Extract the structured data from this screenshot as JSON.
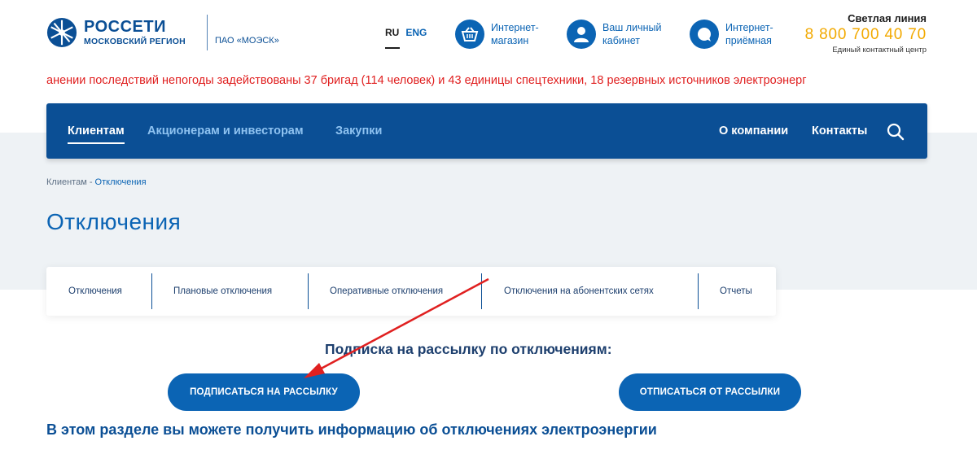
{
  "header": {
    "logo": {
      "name": "РОССЕТИ",
      "region": "МОСКОВСКИЙ РЕГИОН",
      "company": "ПАО «МОЭСК»"
    },
    "lang": {
      "ru": "RU",
      "eng": "ENG"
    },
    "links": [
      {
        "line1": "Интернет-",
        "line2": "магазин",
        "icon": "basket-icon"
      },
      {
        "line1": "Ваш личный",
        "line2": "кабинет",
        "icon": "user-icon"
      },
      {
        "line1": "Интернет-",
        "line2": "приёмная",
        "icon": "chat-icon"
      }
    ],
    "hotline": {
      "title": "Светлая линия",
      "phone": "8 800 700 40 70",
      "subtitle": "Единый контактный центр"
    }
  },
  "ticker": {
    "text": "анении последствий непогоды задействованы 37 бригад (114 человек) и 43 единицы спецтехники, 18 резервных источников электроэнерг"
  },
  "nav": {
    "left": [
      "Клиентам",
      "Акционерам и инвесторам",
      "Закупки"
    ],
    "right": [
      "О компании",
      "Контакты"
    ]
  },
  "breadcrumb": {
    "root": "Клиентам",
    "sep": " - ",
    "current": "Отключения"
  },
  "page_title": "Отключения",
  "tabs": [
    "Отключения",
    "Плановые отключения",
    "Оперативные отключения",
    "Отключения на абонентских сетях",
    "Отчеты"
  ],
  "subscription": {
    "title": "Подписка на рассылку по отключениям:",
    "subscribe": "Подписаться на рассылку",
    "unsubscribe": "Отписаться от рассылки"
  },
  "section_heading": "В этом разделе вы можете получить информацию об отключениях электроэнергии",
  "colors": {
    "brand": "#0b4f95",
    "accent": "#0b64b4",
    "phone": "#f2a900",
    "ticker": "#e01f1f",
    "annotation": "#e02020"
  }
}
